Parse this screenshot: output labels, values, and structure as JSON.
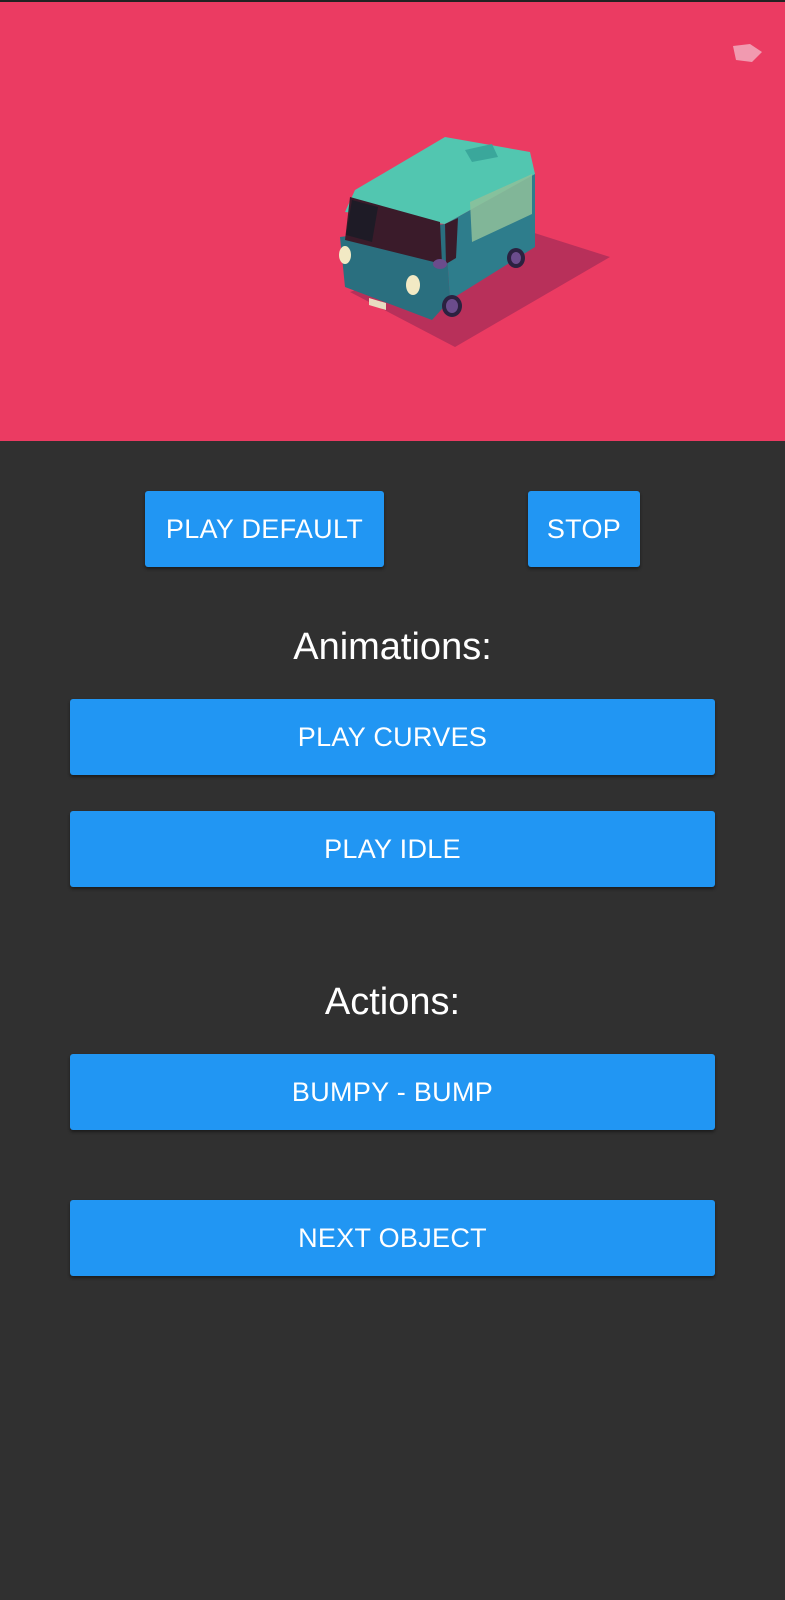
{
  "scene": {
    "background_color": "#eb3b62",
    "object": "van-model",
    "corner_icon": "gem-icon"
  },
  "buttons": {
    "play_default": "PLAY DEFAULT",
    "stop": "STOP",
    "play_curves": "PLAY CURVES",
    "play_idle": "PLAY IDLE",
    "bumpy_bump": "BUMPY - BUMP",
    "next_object": "NEXT OBJECT"
  },
  "headings": {
    "animations": "Animations:",
    "actions": "Actions:"
  },
  "colors": {
    "button": "#2196f3",
    "panel": "#303030",
    "accent_scene": "#eb3b62"
  }
}
